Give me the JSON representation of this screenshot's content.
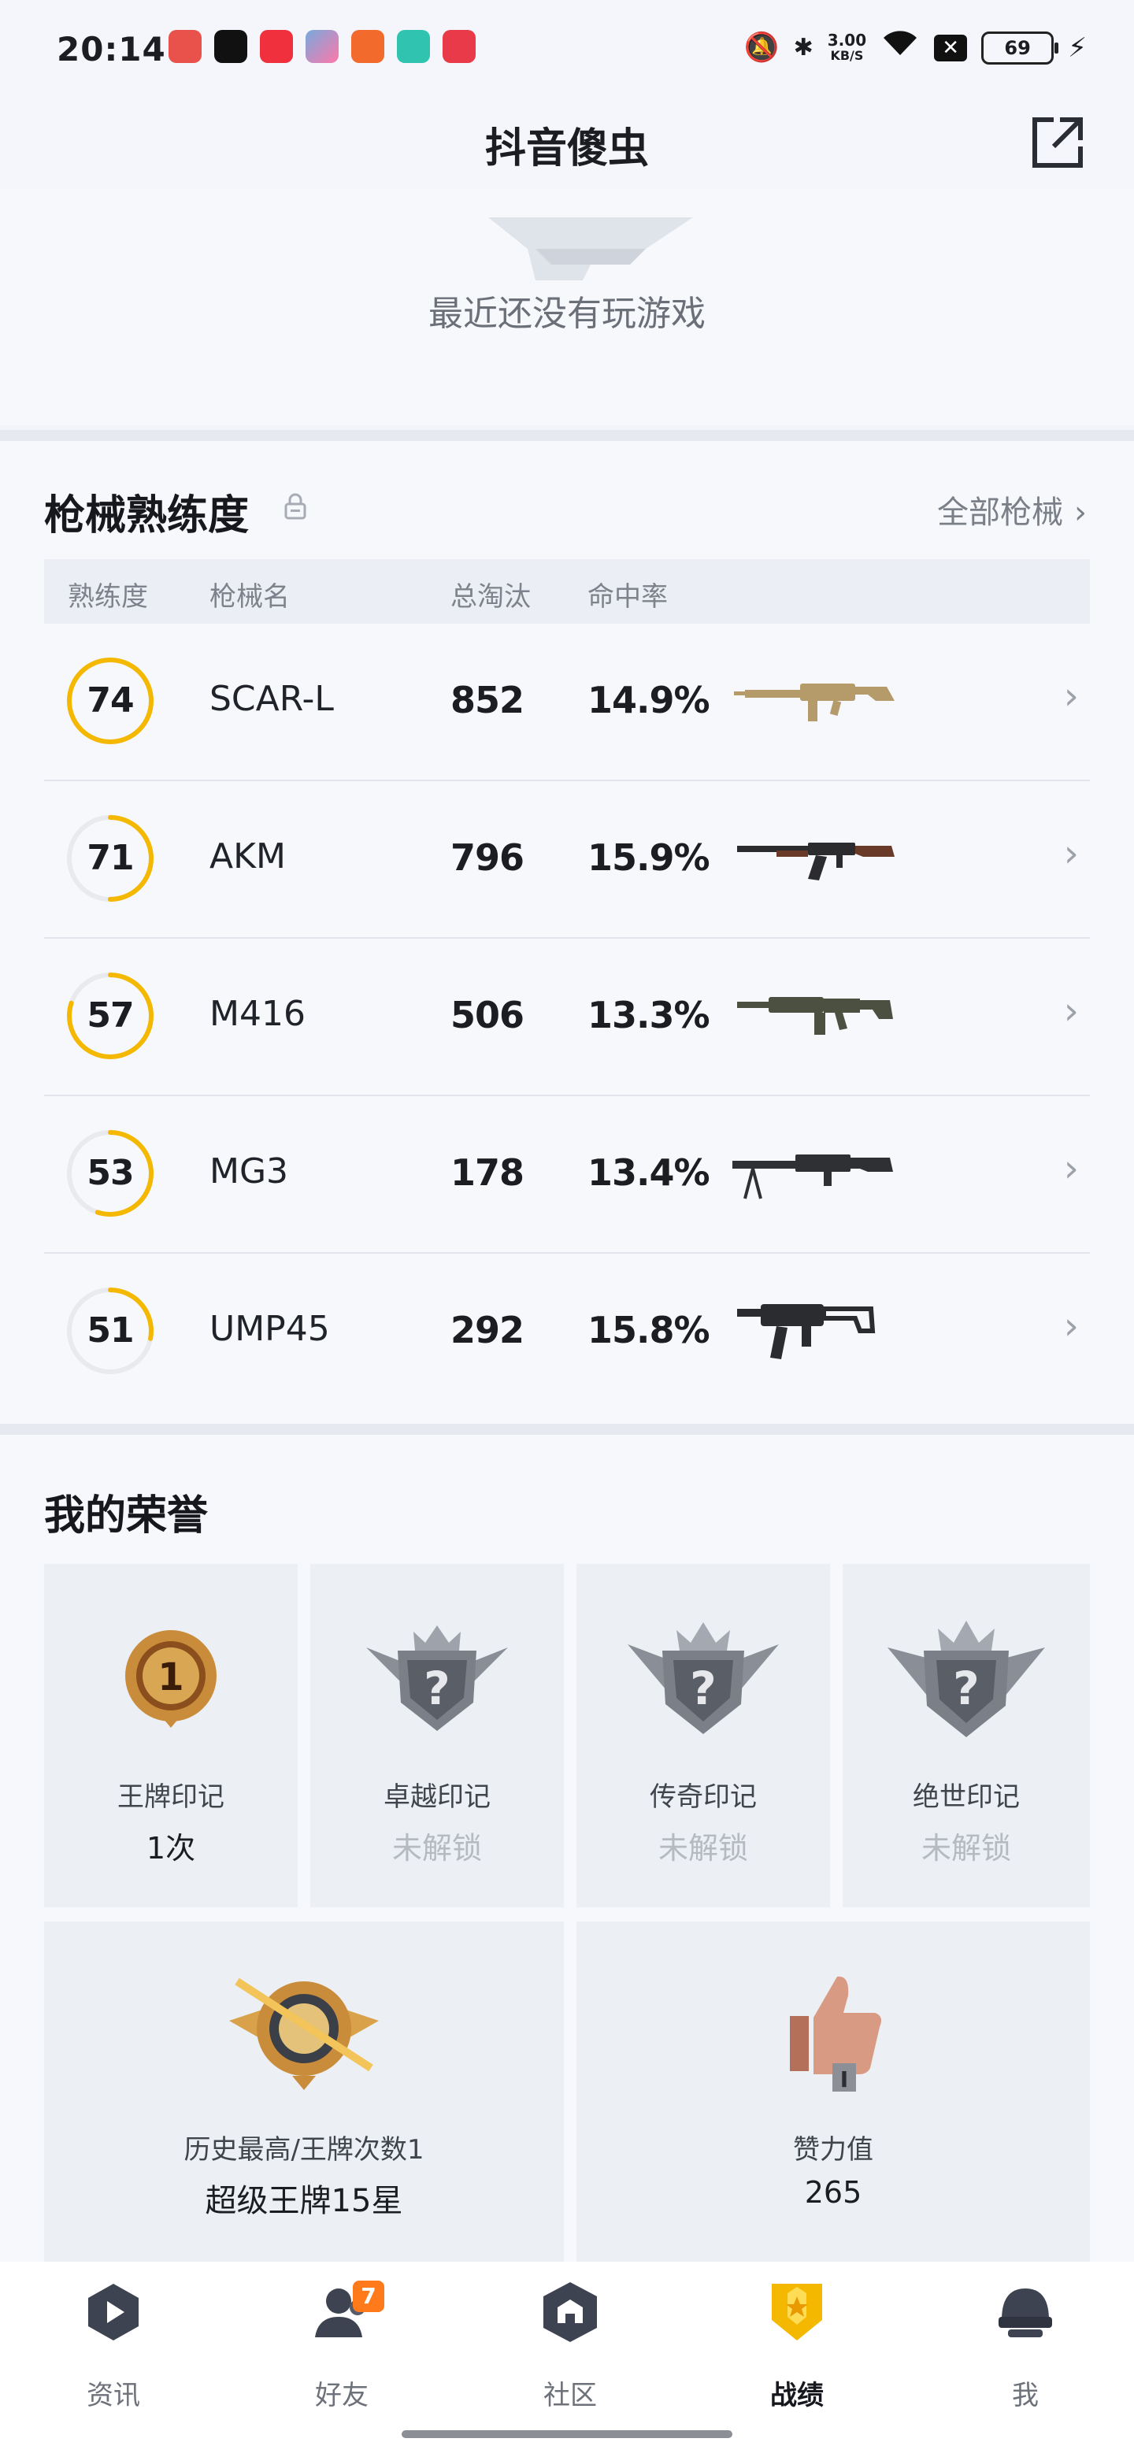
{
  "status_bar": {
    "time": "20:14",
    "speed_value": "3.00",
    "speed_unit": "KB/S",
    "battery": "69"
  },
  "header": {
    "title": "抖音傻虫"
  },
  "recent": {
    "empty_text": "最近还没有玩游戏"
  },
  "weapons": {
    "title": "枪械熟练度",
    "all_link": "全部枪械",
    "columns": {
      "proficiency": "熟练度",
      "name": "枪械名",
      "kills": "总淘汰",
      "hit_rate": "命中率"
    },
    "rows": [
      {
        "proficiency": 74,
        "name": "SCAR-L",
        "kills": "852",
        "hit_rate": "14.9%",
        "ring_fill": 1.0,
        "gun_color": "#b59a6a"
      },
      {
        "proficiency": 71,
        "name": "AKM",
        "kills": "796",
        "hit_rate": "15.9%",
        "ring_fill": 0.5,
        "gun_color": "#6a3a28"
      },
      {
        "proficiency": 57,
        "name": "M416",
        "kills": "506",
        "hit_rate": "13.3%",
        "ring_fill": 0.8,
        "gun_color": "#4b5040"
      },
      {
        "proficiency": 53,
        "name": "MG3",
        "kills": "178",
        "hit_rate": "13.4%",
        "ring_fill": 0.55,
        "gun_color": "#2e3033"
      },
      {
        "proficiency": 51,
        "name": "UMP45",
        "kills": "292",
        "hit_rate": "15.8%",
        "ring_fill": 0.28,
        "gun_color": "#2a2c2f"
      }
    ]
  },
  "honors": {
    "title": "我的荣誉",
    "marks": [
      {
        "label": "王牌印记",
        "value": "1次",
        "locked": false,
        "icon": "ace-medal-icon"
      },
      {
        "label": "卓越印记",
        "value": "未解锁",
        "locked": true,
        "icon": "locked-shield-icon"
      },
      {
        "label": "传奇印记",
        "value": "未解锁",
        "locked": true,
        "icon": "locked-shield-icon"
      },
      {
        "label": "绝世印记",
        "value": "未解锁",
        "locked": true,
        "icon": "locked-shield-icon"
      }
    ],
    "history": {
      "label": "历史最高/王牌次数1",
      "value": "超级王牌15星"
    },
    "likes": {
      "label": "赞力值",
      "value": "265"
    }
  },
  "nav": {
    "items": [
      {
        "label": "资讯",
        "icon": "news-play-icon"
      },
      {
        "label": "好友",
        "icon": "friends-icon",
        "badge": "7"
      },
      {
        "label": "社区",
        "icon": "community-icon"
      },
      {
        "label": "战绩",
        "icon": "record-shield-icon",
        "active": true
      },
      {
        "label": "我",
        "icon": "helmet-icon"
      }
    ]
  },
  "colors": {
    "accent": "#f5b800",
    "ring_track": "#e8eaee",
    "badge": "#ff7a1a"
  }
}
